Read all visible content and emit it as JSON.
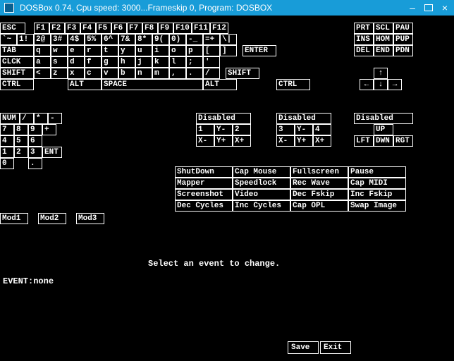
{
  "titlebar": {
    "text": "DOSBox 0.74, Cpu speed:       3000...Frameskip  0, Program:    DOSBOX"
  },
  "instruction": "Select an event to change.",
  "event_label": "EVENT:",
  "event_value": "none",
  "bottom": {
    "save": "Save",
    "exit": "Exit"
  },
  "kbd": {
    "r1": [
      "ESC",
      "F1",
      "F2",
      "F3",
      "F4",
      "F5",
      "F6",
      "F7",
      "F8",
      "F9",
      "F10",
      "F11",
      "F12"
    ],
    "r1b": [
      "PRT",
      "SCL",
      "PAU"
    ],
    "r2": [
      "`~",
      "1!",
      "2@",
      "3#",
      "4$",
      "5%",
      "6^",
      "7&",
      "8*",
      "9(",
      "0)",
      "-_",
      "=+",
      "\\|"
    ],
    "r2b": [
      "INS",
      "HOM",
      "PUP"
    ],
    "r3": [
      "TAB",
      "q",
      "w",
      "e",
      "r",
      "t",
      "y",
      "u",
      "i",
      "o",
      "p",
      "[",
      "]",
      "ENTER"
    ],
    "r3b": [
      "DEL",
      "END",
      "PDN"
    ],
    "r4": [
      "CLCK",
      "a",
      "s",
      "d",
      "f",
      "g",
      "h",
      "j",
      "k",
      "l",
      ";",
      "'"
    ],
    "r5": [
      "SHIFT",
      "<",
      "z",
      "x",
      "c",
      "v",
      "b",
      "n",
      "m",
      ",",
      ".",
      "/",
      "SHIFT"
    ],
    "r5_up": "↑",
    "r6": {
      "ctrl1": "CTRL",
      "alt1": "ALT",
      "space": "SPACE",
      "alt2": "ALT",
      "ctrl2": "CTRL",
      "left": "←",
      "down": "↓",
      "right": "→"
    }
  },
  "numpad": {
    "r1": [
      "NUM",
      "/",
      "*",
      "-"
    ],
    "r2": [
      "7",
      "8",
      "9",
      "+"
    ],
    "r3": [
      "4",
      "5",
      "6"
    ],
    "r4": [
      "1",
      "2",
      "3",
      "ENT"
    ],
    "r5": [
      "0",
      "."
    ]
  },
  "joy1": {
    "title": "Disabled",
    "r2": [
      "1",
      "Y-",
      "2"
    ],
    "r3": [
      "X-",
      "Y+",
      "X+"
    ]
  },
  "joy2": {
    "title": "Disabled",
    "r2": [
      "3",
      "Y-",
      "4"
    ],
    "r3": [
      "X-",
      "Y+",
      "X+"
    ]
  },
  "joy3": {
    "title": "Disabled",
    "r2": [
      "UP"
    ],
    "r3": [
      "LFT",
      "DWN",
      "RGT"
    ]
  },
  "actions": {
    "r1": [
      "ShutDown",
      "Cap Mouse",
      "Fullscreen",
      "Pause"
    ],
    "r2": [
      "Mapper",
      "Speedlock",
      "Rec Wave",
      "Cap MIDI"
    ],
    "r3": [
      "Screenshot",
      "Video",
      "Dec Fskip",
      "Inc Fskip"
    ],
    "r4": [
      "Dec Cycles",
      "Inc Cycles",
      "Cap OPL",
      "Swap Image"
    ]
  },
  "mods": [
    "Mod1",
    "Mod2",
    "Mod3"
  ]
}
